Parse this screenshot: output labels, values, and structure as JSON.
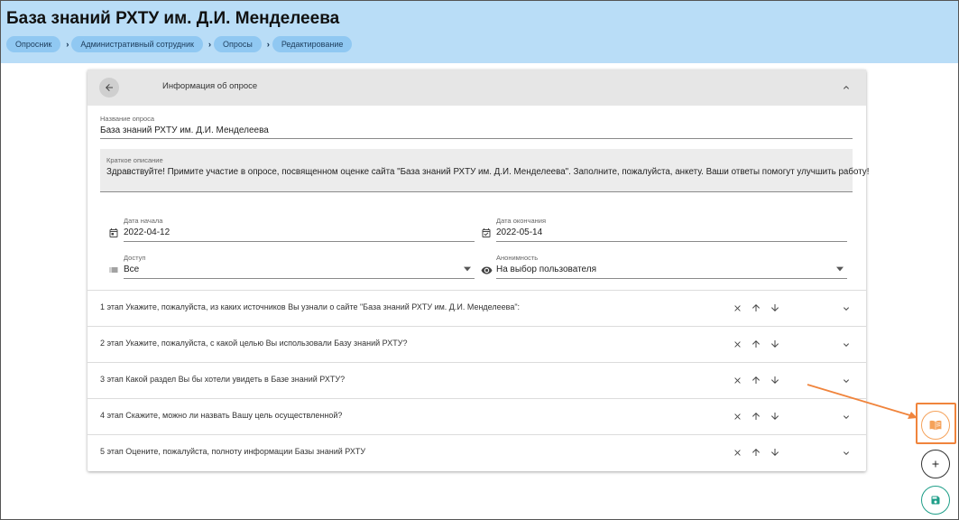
{
  "header": {
    "title": "База знаний РХТУ им. Д.И. Менделеева",
    "breadcrumbs": [
      "Опросник",
      "Административный сотрудник",
      "Опросы",
      "Редактирование"
    ]
  },
  "card": {
    "title": "Информация об опросе",
    "name_label": "Название опроса",
    "name_value": "База знаний РХТУ им. Д.И. Менделеева",
    "desc_label": "Краткое описание",
    "desc_value": "Здравствуйте! Примите участие в опросе, посвященном оценке сайта \"База знаний РХТУ им. Д.И. Менделеева\". Заполните, пожалуйста, анкету. Ваши ответы помогут улучшить работу!",
    "start_label": "Дата начала",
    "start_value": "2022-04-12",
    "end_label": "Дата окончания",
    "end_value": "2022-05-14",
    "access_label": "Доступ",
    "access_value": "Все",
    "anon_label": "Анонимность",
    "anon_value": "На выбор пользователя"
  },
  "stages": [
    "1 этап Укажите, пожалуйста, из каких источников Вы узнали о сайте \"База знаний РХТУ им. Д.И. Менделеева\":",
    "2 этап Укажите, пожалуйста, с какой целью Вы использовали Базу знаний РХТУ?",
    "3 этап Какой раздел Вы бы хотели увидеть в Базе знаний РХТУ?",
    "4 этап Скажите, можно ли назвать Вашу цель осуществленной?",
    "5 этап Оцените, пожалуйста, полноту информации Базы знаний РХТУ"
  ],
  "colors": {
    "header_bg": "#b9ddf7",
    "crumb_bg": "#90c8f2",
    "annotation": "#f0843c",
    "save_accent": "#1e9e88",
    "book_accent": "#f5a25a"
  },
  "icons": {
    "back": "arrow-left-icon",
    "collapse": "chevron-up-icon",
    "start_date": "calendar-icon",
    "end_date": "calendar-check-icon",
    "access": "list-icon",
    "anonymity": "eye-icon",
    "delete": "close-icon",
    "move_up": "arrow-up-icon",
    "move_down": "arrow-down-icon",
    "expand": "chevron-down-icon",
    "fab_book": "book-open-icon",
    "fab_add": "plus-icon",
    "fab_save": "save-icon"
  }
}
